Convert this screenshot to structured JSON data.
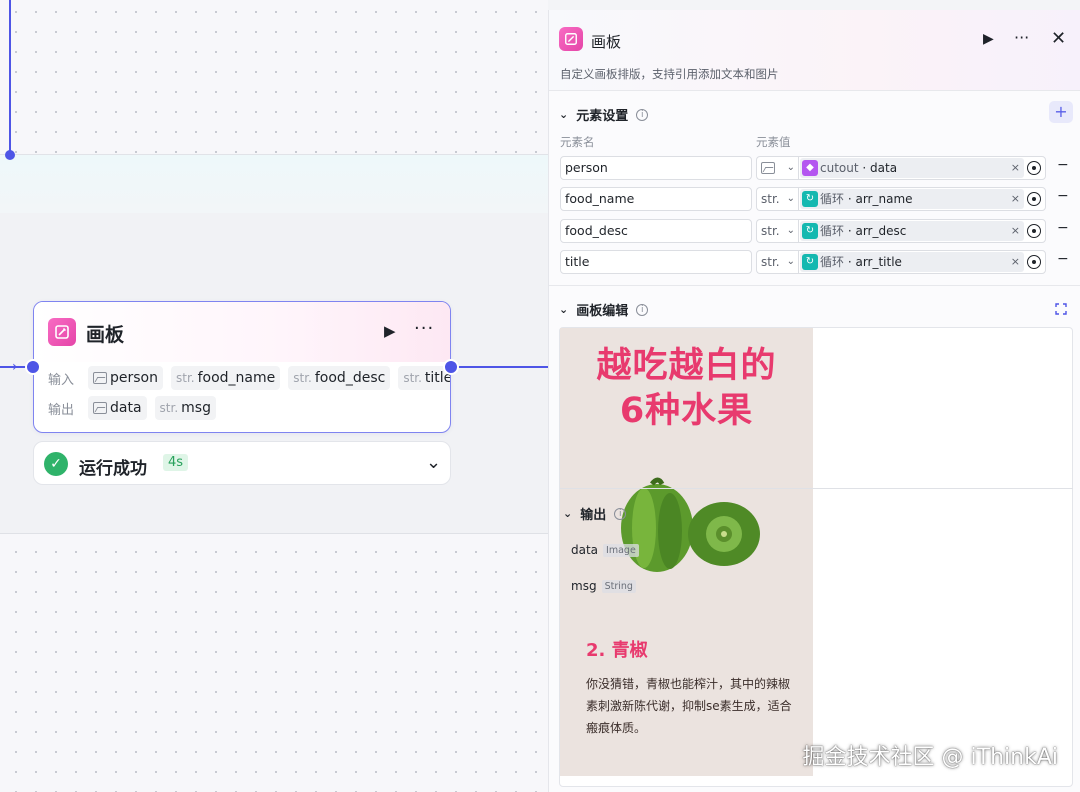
{
  "node": {
    "title": "画板",
    "input_label": "输入",
    "output_label": "输出",
    "inputs": [
      {
        "type": "",
        "name": "person"
      },
      {
        "type": "str.",
        "name": "food_name"
      },
      {
        "type": "str.",
        "name": "food_desc"
      },
      {
        "type": "str.",
        "name": "title"
      }
    ],
    "outputs": [
      {
        "type": "",
        "name": "data"
      },
      {
        "type": "str.",
        "name": "msg"
      }
    ],
    "status": {
      "text": "运行成功",
      "time": "4s"
    },
    "icons": {
      "run": "play-icon",
      "more": "more-icon",
      "status": "check-circle-icon",
      "expand": "chevron-down-icon"
    }
  },
  "panel": {
    "title": "画板",
    "description": "自定义画板排版，支持引用添加文本和图片",
    "element_settings": {
      "title": "元素设置",
      "col_name": "元素名",
      "col_value": "元素值",
      "rows": [
        {
          "name": "person",
          "type": "",
          "source": "cutout",
          "var": "data",
          "icon": "cutout-icon"
        },
        {
          "name": "food_name",
          "type": "str.",
          "source": "循环",
          "var": "arr_name",
          "icon": "loop-icon"
        },
        {
          "name": "food_desc",
          "type": "str.",
          "source": "循环",
          "var": "arr_desc",
          "icon": "loop-icon"
        },
        {
          "name": "title",
          "type": "str.",
          "source": "循环",
          "var": "arr_title",
          "icon": "loop-icon"
        }
      ]
    },
    "canvas_edit": {
      "title": "画板编辑"
    },
    "poster": {
      "title_line1": "越吃越白的",
      "title_line2": "6种水果",
      "subtitle": "2. 青椒",
      "desc": "你没猜错，青椒也能榨汁，其中的辣椒素刺激新陈代谢，抑制se素生成，适合瘢痕体质。"
    },
    "output": {
      "title": "输出",
      "rows": [
        {
          "name": "data",
          "type": "Image"
        },
        {
          "name": "msg",
          "type": "String"
        }
      ]
    }
  },
  "watermark": "掘金技术社区 @ iThinkAi",
  "colors": {
    "accent": "#4e55e6",
    "brand_pink": "#e545a8",
    "poster_red": "#e83a6e",
    "success": "#2fb36a"
  }
}
